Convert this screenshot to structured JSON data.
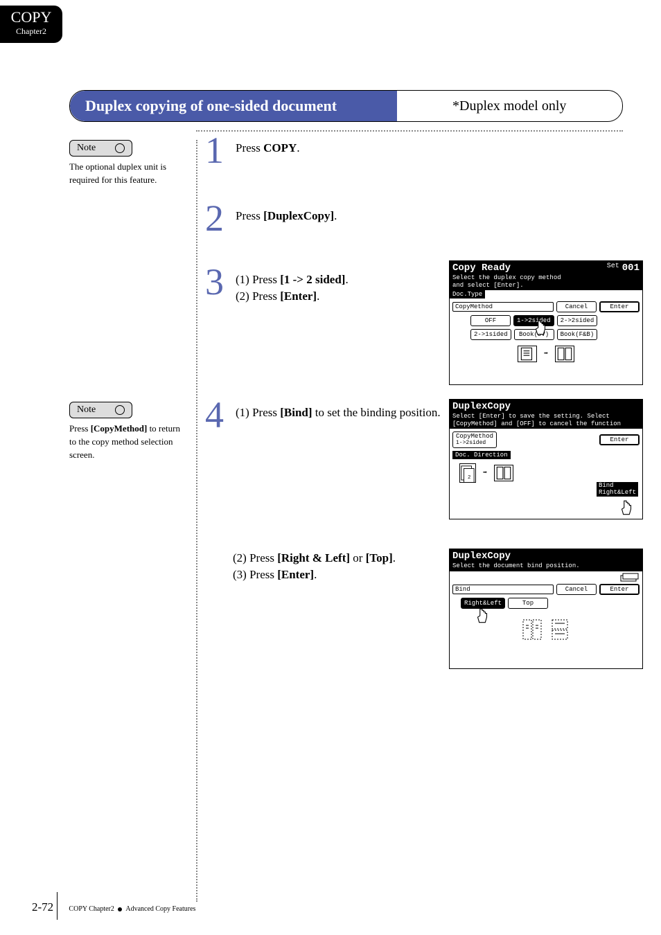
{
  "tab": {
    "title": "COPY",
    "subtitle": "Chapter2"
  },
  "section": {
    "title": "Duplex copying of one-sided document",
    "aside": "*Duplex model only"
  },
  "note1": {
    "label": "Note",
    "text": "The optional duplex unit is required for this feature."
  },
  "note2": {
    "label": "Note",
    "text": "Press [CopyMethod] to return to the copy method selection screen."
  },
  "steps": {
    "s1": {
      "num": "1",
      "pre": "Press ",
      "key": "COPY",
      "post": "."
    },
    "s2": {
      "num": "2",
      "pre": "Press ",
      "key": "[DuplexCopy]",
      "post": "."
    },
    "s3": {
      "num": "3",
      "l1a": "(1) Press ",
      "l1b": "[1 -> 2 sided]",
      "l1c": ".",
      "l2a": "(2) Press ",
      "l2b": "[Enter]",
      "l2c": "."
    },
    "s4": {
      "num": "4",
      "l1a": "(1) Press ",
      "l1b": "[Bind]",
      "l1c": " to set the binding position.",
      "l2a": "(2) Press ",
      "l2b": "[Right & Left]",
      "l2c": " or ",
      "l2d": "[Top]",
      "l2e": ".",
      "l3a": "(3) Press ",
      "l3b": "[Enter]",
      "l3c": "."
    }
  },
  "screen1": {
    "title": "Copy Ready",
    "set": "Set",
    "setnum": "001",
    "msg1": "Select the duplex copy method",
    "msg2": "and select [Enter].",
    "tab": "Doc.Type",
    "row_label": "CopyMethod",
    "cancel": "Cancel",
    "enter": "Enter",
    "b_off": "OFF",
    "b_12": "1->2sided",
    "b_22": "2->2sided",
    "b_21": "2->1sided",
    "b_book": "Book(DV)",
    "b_bookfb": "Book(F&B)"
  },
  "screen2": {
    "title": "DuplexCopy",
    "msg1": "Select [Enter] to save the setting. Select",
    "msg2": "[CopyMethod] and [OFF] to cancel the function",
    "cm_label1": "CopyMethod",
    "cm_label2": "1->2sided",
    "dir": "Doc. Direction",
    "enter": "Enter",
    "bind_l1": "Bind",
    "bind_l2": "Right&Left"
  },
  "screen3": {
    "title": "DuplexCopy",
    "msg": "Select the document bind position.",
    "row_label": "Bind",
    "cancel": "Cancel",
    "enter": "Enter",
    "b_rl": "Right&Left",
    "b_top": "Top"
  },
  "footer": {
    "page": "2-72",
    "crumb1": "COPY Chapter2",
    "crumb2": "Advanced Copy Features"
  }
}
